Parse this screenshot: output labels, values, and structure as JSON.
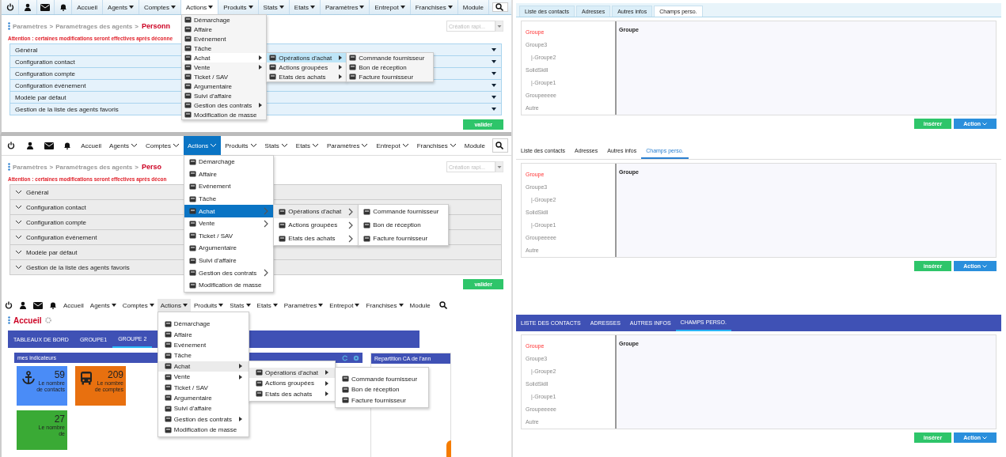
{
  "screens": [
    {
      "kind": "classic",
      "nav_items": [
        {
          "label": "Accueil",
          "dropdown": false,
          "selected": false
        },
        {
          "label": "Agents",
          "dropdown": true,
          "selected": false
        },
        {
          "label": "Comptes",
          "dropdown": true,
          "selected": false
        },
        {
          "label": "Actions",
          "dropdown": true,
          "selected": true
        },
        {
          "label": "Produits",
          "dropdown": true,
          "selected": false
        },
        {
          "label": "Stats",
          "dropdown": true,
          "selected": false
        },
        {
          "label": "Etats",
          "dropdown": true,
          "selected": false
        },
        {
          "label": "Paramètres",
          "dropdown": true,
          "selected": false
        },
        {
          "label": "Entrepot",
          "dropdown": true,
          "selected": false
        },
        {
          "label": "Franchises",
          "dropdown": true,
          "selected": false
        },
        {
          "label": "Module",
          "dropdown": false,
          "selected": false
        }
      ],
      "menu": [
        {
          "label": "Démarchage",
          "submenu": false,
          "selected": false
        },
        {
          "label": "Affaire",
          "submenu": false,
          "selected": false
        },
        {
          "label": "Evénement",
          "submenu": false,
          "selected": false
        },
        {
          "label": "Tâche",
          "submenu": false,
          "selected": false
        },
        {
          "label": "Achat",
          "submenu": true,
          "selected": true
        },
        {
          "label": "Vente",
          "submenu": true,
          "selected": false
        },
        {
          "label": "Ticket / SAV",
          "submenu": false,
          "selected": false
        },
        {
          "label": "Argumentaire",
          "submenu": false,
          "selected": false
        },
        {
          "label": "Suivi d'affaire",
          "submenu": false,
          "selected": false
        },
        {
          "label": "Gestion des contrats",
          "submenu": true,
          "selected": false
        },
        {
          "label": "Modification de masse",
          "submenu": false,
          "selected": false
        }
      ],
      "submenu": [
        {
          "label": "Opérations d'achat",
          "submenu": true,
          "selected": true
        },
        {
          "label": "Actions groupées",
          "submenu": true,
          "selected": false
        },
        {
          "label": "Etats des achats",
          "submenu": true,
          "selected": false
        }
      ],
      "subsubmenu": [
        {
          "label": "Commande fournisseur"
        },
        {
          "label": "Bon de réception"
        },
        {
          "label": "Facture fournisseur"
        }
      ],
      "page": {
        "kind": "settings",
        "breadcrumb": [
          "Paramètres",
          "Paramétrages des agents",
          "Personn"
        ],
        "separator": ">",
        "quick_create": {
          "placeholder": "Création rapi..."
        },
        "warning": "Attention : certaines modifications seront effectives après déconne",
        "sections": [
          "Général",
          "Configuration contact",
          "Configuration compte",
          "Configuration événement",
          "Modèle par défaut",
          "Gestion de la liste des agents favoris"
        ],
        "submit": "valider"
      }
    },
    {
      "kind": "flat",
      "nav_items": [
        {
          "label": "Accueil",
          "dropdown": false,
          "selected": false
        },
        {
          "label": "Agents",
          "dropdown": true,
          "selected": false
        },
        {
          "label": "Comptes",
          "dropdown": true,
          "selected": false
        },
        {
          "label": "Actions",
          "dropdown": true,
          "selected": true
        },
        {
          "label": "Produits",
          "dropdown": true,
          "selected": false
        },
        {
          "label": "Stats",
          "dropdown": true,
          "selected": false
        },
        {
          "label": "Etats",
          "dropdown": true,
          "selected": false
        },
        {
          "label": "Paramètres",
          "dropdown": true,
          "selected": false
        },
        {
          "label": "Entrepot",
          "dropdown": true,
          "selected": false
        },
        {
          "label": "Franchises",
          "dropdown": true,
          "selected": false
        },
        {
          "label": "Module",
          "dropdown": false,
          "selected": false
        }
      ],
      "menu": [
        {
          "label": "Démarchage",
          "submenu": false,
          "selected": false
        },
        {
          "label": "Affaire",
          "submenu": false,
          "selected": false
        },
        {
          "label": "Evénement",
          "submenu": false,
          "selected": false
        },
        {
          "label": "Tâche",
          "submenu": false,
          "selected": false
        },
        {
          "label": "Achat",
          "submenu": true,
          "selected": true
        },
        {
          "label": "Vente",
          "submenu": true,
          "selected": false
        },
        {
          "label": "Ticket / SAV",
          "submenu": false,
          "selected": false
        },
        {
          "label": "Argumentaire",
          "submenu": false,
          "selected": false
        },
        {
          "label": "Suivi d'affaire",
          "submenu": false,
          "selected": false
        },
        {
          "label": "Gestion des contrats",
          "submenu": true,
          "selected": false
        },
        {
          "label": "Modification de masse",
          "submenu": false,
          "selected": false
        }
      ],
      "submenu": [
        {
          "label": "Opérations d'achat",
          "submenu": true,
          "selected": true
        },
        {
          "label": "Actions groupées",
          "submenu": true,
          "selected": false
        },
        {
          "label": "Etats des achats",
          "submenu": true,
          "selected": false
        }
      ],
      "subsubmenu": [
        {
          "label": "Commande fournisseur"
        },
        {
          "label": "Bon de réception"
        },
        {
          "label": "Facture fournisseur"
        }
      ],
      "page": {
        "kind": "settings",
        "breadcrumb": [
          "Paramètres",
          "Paramétrages des agents",
          "Perso"
        ],
        "separator": ">",
        "quick_create": {
          "placeholder": "Création rapi..."
        },
        "warning": "Attention : certaines modifications seront effectives après décon",
        "sections": [
          "Général",
          "Configuration contact",
          "Configuration compte",
          "Configuration événement",
          "Modèle par défaut",
          "Gestion de la liste des agents favoris"
        ],
        "submit": "valider"
      }
    },
    {
      "kind": "material",
      "nav_items": [
        {
          "label": "Accueil",
          "dropdown": false,
          "selected": false
        },
        {
          "label": "Agents",
          "dropdown": true,
          "selected": false
        },
        {
          "label": "Comptes",
          "dropdown": true,
          "selected": false
        },
        {
          "label": "Actions",
          "dropdown": true,
          "selected": true
        },
        {
          "label": "Produits",
          "dropdown": true,
          "selected": false
        },
        {
          "label": "Stats",
          "dropdown": true,
          "selected": false
        },
        {
          "label": "Etats",
          "dropdown": true,
          "selected": false
        },
        {
          "label": "Paramètres",
          "dropdown": true,
          "selected": false
        },
        {
          "label": "Entrepot",
          "dropdown": true,
          "selected": false
        },
        {
          "label": "Franchises",
          "dropdown": true,
          "selected": false
        },
        {
          "label": "Module",
          "dropdown": false,
          "selected": false
        }
      ],
      "menu": [
        {
          "label": "Démarchage",
          "submenu": false,
          "selected": false
        },
        {
          "label": "Affaire",
          "submenu": false,
          "selected": false
        },
        {
          "label": "Evénement",
          "submenu": false,
          "selected": false
        },
        {
          "label": "Tâche",
          "submenu": false,
          "selected": false
        },
        {
          "label": "Achat",
          "submenu": true,
          "selected": true
        },
        {
          "label": "Vente",
          "submenu": true,
          "selected": false
        },
        {
          "label": "Ticket / SAV",
          "submenu": false,
          "selected": false
        },
        {
          "label": "Argumentaire",
          "submenu": false,
          "selected": false
        },
        {
          "label": "Suivi d'affaire",
          "submenu": false,
          "selected": false
        },
        {
          "label": "Gestion des contrats",
          "submenu": true,
          "selected": false
        },
        {
          "label": "Modification de masse",
          "submenu": false,
          "selected": false
        }
      ],
      "submenu": [
        {
          "label": "Opérations d'achat",
          "submenu": true,
          "selected": true
        },
        {
          "label": "Actions groupées",
          "submenu": true,
          "selected": false
        },
        {
          "label": "Etats des achats",
          "submenu": true,
          "selected": false
        }
      ],
      "subsubmenu": [
        {
          "label": "Commande fournisseur"
        },
        {
          "label": "Bon de réception"
        },
        {
          "label": "Facture fournisseur"
        }
      ],
      "page": {
        "kind": "dashboard",
        "title": "Accueil",
        "tabs": [
          {
            "label": "TABLEAUX DE BORD",
            "selected": false
          },
          {
            "label": "GROUPE1",
            "selected": false
          },
          {
            "label": "GROUPE 2",
            "selected": true
          }
        ],
        "widgets": [
          {
            "title": "mes indicateurs"
          },
          {
            "title": "Repartition CA de l'ann"
          }
        ],
        "indicators": [
          {
            "value": "59",
            "label": "Le nombre de contacts",
            "color": "#4a8cf7"
          },
          {
            "value": "209",
            "label": "Le nombre de comptes",
            "color": "#e8700f"
          },
          {
            "value": "27",
            "label": "Le nombre de",
            "color": "#3aaa35"
          }
        ]
      }
    }
  ],
  "panels": [
    {
      "kind": "classic",
      "tabs": [
        {
          "label": "Liste des contacts",
          "selected": false
        },
        {
          "label": "Adresses",
          "selected": false
        },
        {
          "label": "Autres infos",
          "selected": false
        },
        {
          "label": "Champs perso.",
          "selected": true
        }
      ],
      "tree": [
        {
          "label": "Groupe",
          "selected": true
        },
        {
          "label": "Groupe3",
          "selected": false,
          "children": [
            {
              "label": "|-Groupe2",
              "selected": false
            }
          ]
        },
        {
          "label": "SolidSkill",
          "selected": false,
          "children": [
            {
              "label": "|-Groupe1",
              "selected": false
            }
          ]
        },
        {
          "label": "Groupeeeee",
          "selected": false
        },
        {
          "label": "Autre",
          "selected": false
        }
      ],
      "heading": "Groupe",
      "buttons": [
        {
          "label": "insérer",
          "kind": "primary"
        },
        {
          "label": "Action",
          "kind": "dropdown"
        }
      ]
    },
    {
      "kind": "flat",
      "tabs": [
        {
          "label": "Liste des contacts",
          "selected": false
        },
        {
          "label": "Adresses",
          "selected": false
        },
        {
          "label": "Autres infos",
          "selected": false
        },
        {
          "label": "Champs perso.",
          "selected": true
        }
      ],
      "tree": [
        {
          "label": "Groupe",
          "selected": true
        },
        {
          "label": "Groupe3",
          "selected": false,
          "children": [
            {
              "label": "|-Groupe2",
              "selected": false
            }
          ]
        },
        {
          "label": "SolidSkill",
          "selected": false,
          "children": [
            {
              "label": "|-Groupe1",
              "selected": false
            }
          ]
        },
        {
          "label": "Groupeeeee",
          "selected": false
        },
        {
          "label": "Autre",
          "selected": false
        }
      ],
      "heading": "Groupe",
      "buttons": [
        {
          "label": "insérer",
          "kind": "primary"
        },
        {
          "label": "Action",
          "kind": "dropdown"
        }
      ]
    },
    {
      "kind": "material",
      "tabs": [
        {
          "label": "LISTE DES CONTACTS",
          "selected": false
        },
        {
          "label": "ADRESSES",
          "selected": false
        },
        {
          "label": "AUTRES INFOS",
          "selected": false
        },
        {
          "label": "CHAMPS PERSO.",
          "selected": true
        }
      ],
      "tree": [
        {
          "label": "Groupe",
          "selected": true
        },
        {
          "label": "Groupe3",
          "selected": false,
          "children": [
            {
              "label": "|-Groupe2",
              "selected": false
            }
          ]
        },
        {
          "label": "SolidSkill",
          "selected": false,
          "children": [
            {
              "label": "|-Groupe1",
              "selected": false
            }
          ]
        },
        {
          "label": "Groupeeeee",
          "selected": false
        },
        {
          "label": "Autre",
          "selected": false
        }
      ],
      "heading": "Groupe",
      "buttons": [
        {
          "label": "insérer",
          "kind": "primary"
        },
        {
          "label": "Action",
          "kind": "dropdown"
        }
      ]
    }
  ]
}
